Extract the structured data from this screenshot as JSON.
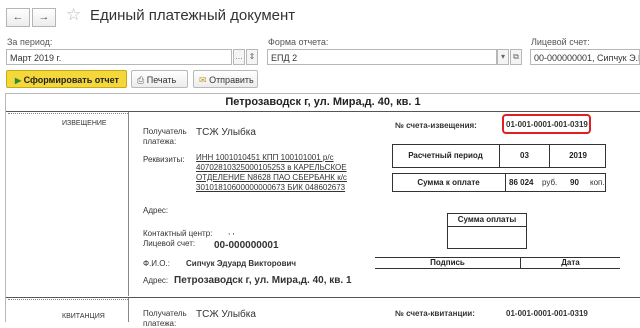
{
  "window": {
    "title": "Единый платежный документ",
    "nav_back": "←",
    "nav_forward": "→",
    "favorite_icon": "☆"
  },
  "filters": {
    "period_label": "За период:",
    "period_value": "Март 2019 г.",
    "form_label": "Форма отчета:",
    "form_value": "ЕПД 2",
    "account_label": "Лицевой счет:",
    "account_value": "00-000000001, Сипчук Э.В."
  },
  "toolbar": {
    "generate": "Сформировать отчет",
    "print": "Печать",
    "send": "Отправить"
  },
  "document": {
    "address_title": "Петрозаводск г, ул. Мира,д. 40, кв. 1",
    "section1_label": "ИЗВЕЩЕНИЕ",
    "section2_label": "КВИТАНЦИЯ",
    "recipient_label_1": "Получатель",
    "recipient_label_2": "платежа:",
    "recipient_name": "ТСЖ Улыбка",
    "requisites_label": "Реквизиты:",
    "requisites_lines": [
      "ИНН 1001010451 КПП 100101001 р/с",
      "40702810325000105253  в КАРЕЛЬСКОЕ",
      "ОТДЕЛЕНИЕ N8628 ПАО СБЕРБАНК к/с",
      "30101810600000000673 БИК 048602673"
    ],
    "address_label": "Адрес:",
    "contact_center_label": "Контактный центр:",
    "contact_center_value": ", ,",
    "account_label": "Лицевой счет:",
    "account_value": "00-000000001",
    "fio_label": "Ф.И.О.:",
    "fio_value": "Сипчук Эдуард Викторович",
    "payer_address_label": "Адрес:",
    "payer_address_value": "Петрозаводск г, ул. Мира,д. 40, кв. 1",
    "invoice_label": "№ счета-извещения:",
    "invoice_number": "01-001-0001-001-0319",
    "period_label": "Расчетный период",
    "period_month": "03",
    "period_year": "2019",
    "amount_label": "Сумма к оплате",
    "amount_rub": "86 024",
    "rub_label": "руб.",
    "amount_kop": "90",
    "kop_label": "коп.",
    "paid_label": "Сумма оплаты",
    "signature_label": "Подпись",
    "date_label": "Дата",
    "receipt_invoice_label": "№ счета-квитанции:",
    "receipt_invoice_number": "01-001-0001-001-0319",
    "receipt_recipient_name": "ТСЖ Улыбка"
  },
  "colors": {
    "accent_button": "#f4d73a",
    "highlight_border": "#e02020"
  }
}
